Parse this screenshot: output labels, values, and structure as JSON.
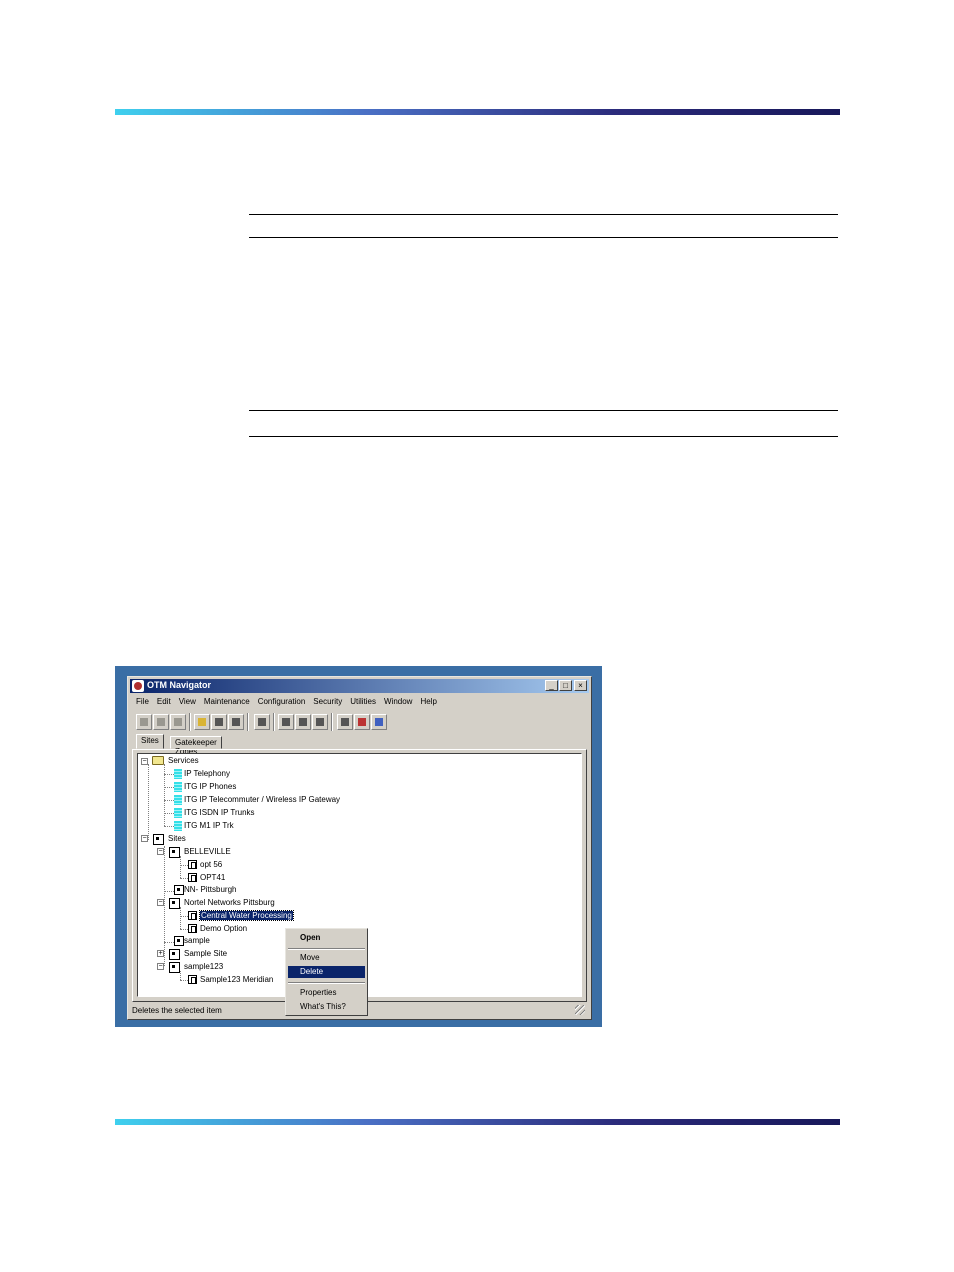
{
  "window": {
    "title": "OTM Navigator",
    "controls": {
      "minimize": "_",
      "maximize": "□",
      "close": "×"
    }
  },
  "menu": [
    "File",
    "Edit",
    "View",
    "Maintenance",
    "Configuration",
    "Security",
    "Utilities",
    "Window",
    "Help"
  ],
  "toolbar": {
    "icons": [
      "properties-icon",
      "list-icon",
      "find-icon",
      "open-folder-icon",
      "print-icon",
      "print-preview-icon",
      "delete-icon",
      "report-icon",
      "user-icon",
      "save-icon",
      "new-window-icon",
      "book-icon",
      "help-icon"
    ]
  },
  "tabs": [
    "Sites",
    "Gatekeeper Zones"
  ],
  "tree": {
    "services": "Services",
    "service_items": [
      "IP Telephony",
      "ITG IP Phones",
      "ITG IP Telecommuter / Wireless IP Gateway",
      "ITG ISDN IP Trunks",
      "ITG M1 IP Trk"
    ],
    "sites": "Sites",
    "belleville": "BELLEVILLE",
    "belleville_items": [
      "opt 56",
      "OPT41"
    ],
    "nn_pittsburgh": "NN- Pittsburgh",
    "nortel": "Nortel Networks Pittsburg",
    "nortel_items": [
      "Central Water Processing",
      "Demo Option"
    ],
    "sample": "sample",
    "sample_site": "Sample Site",
    "sample123": "sample123",
    "sample123_item": "Sample123 Meridian"
  },
  "context_menu": {
    "open": "Open",
    "move": "Move",
    "delete": "Delete",
    "properties": "Properties",
    "whats_this": "What's This?"
  },
  "status_bar": "Deletes the selected item",
  "colors": {
    "band_start": "#3fd0ee",
    "band_end": "#18185a",
    "desktop": "#3a6ea5",
    "titlebar": "#0a246a",
    "selection": "#0a246a"
  }
}
